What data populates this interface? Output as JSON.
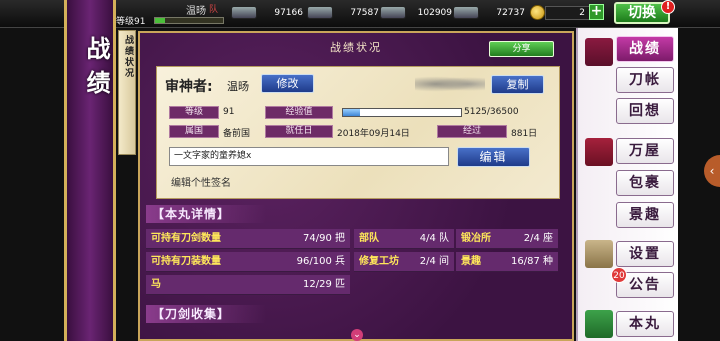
{
  "header": {
    "level_label": "等级",
    "level": "91",
    "level_progress": 0.14,
    "player_name": "温旸",
    "team_tag": "队",
    "resources": [
      {
        "icon": "charcoal-icon",
        "value": "97166"
      },
      {
        "icon": "steel-icon",
        "value": "77587"
      },
      {
        "icon": "cooling-water-icon",
        "value": "102909"
      },
      {
        "icon": "whetstone-icon",
        "value": "72737"
      }
    ],
    "coins": "2",
    "plus_label": "+",
    "switch_label": "切换",
    "alert": "!"
  },
  "left": {
    "title": "战绩",
    "scroll_tab": "战绩状况"
  },
  "main": {
    "title": "战绩状况",
    "share_label": "分享",
    "sage_label": "审神者:",
    "sage_name": "温旸",
    "edit_label": "修改",
    "copy_label": "复制",
    "profile": {
      "level_tag": "等级",
      "level_val": "91",
      "exp_tag": "经验值",
      "exp_val": "5125/36500",
      "exp_progress": 0.14,
      "affil_tag": "属国",
      "affil_val": "备前国",
      "start_tag": "就任日",
      "start_val": "2018年09月14日",
      "elapsed_tag": "经过",
      "elapsed_val": "881日"
    },
    "signature_value": "一文字家的童养媳x",
    "signature_button": "编辑",
    "signature_hint": "编辑个性签名",
    "citadel_head": "【本丸详情】",
    "citadel_stats": [
      {
        "k": "可持有刀剑数量",
        "v": "74/90 把"
      },
      {
        "k": "部队",
        "v": "4/4 队"
      },
      {
        "k": "锻冶所",
        "v": "2/4 座"
      },
      {
        "k": "可持有刀装数量",
        "v": "96/100 兵"
      },
      {
        "k": "修复工坊",
        "v": "2/4 间"
      },
      {
        "k": "景趣",
        "v": "16/87 种"
      },
      {
        "k": "马",
        "v": "12/29 匹"
      }
    ],
    "collection_head": "【刀剑收集】"
  },
  "menu": {
    "items": [
      "战绩",
      "刀帐",
      "回想",
      "万屋",
      "包裹",
      "景趣",
      "设置",
      "公告",
      "本丸"
    ],
    "badge": "20"
  },
  "colors": {
    "accent_green": "#2f9a2a",
    "panel_purple": "#4a1a50",
    "stat_key_yellow": "#ffe85a",
    "button_blue": "#1f3b8a"
  }
}
